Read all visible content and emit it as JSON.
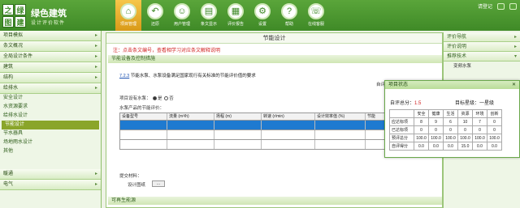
{
  "app": {
    "logo_chars": [
      "之",
      "绿",
      "图",
      "建"
    ],
    "title": "绿色建筑",
    "subtitle": "设计评价软件",
    "user": "请登记"
  },
  "nav": [
    {
      "label": "项目管理",
      "icon": "house-icon",
      "glyph": "⌂",
      "active": true
    },
    {
      "label": "还原",
      "icon": "undo-icon",
      "glyph": "↶",
      "active": false
    },
    {
      "label": "用户管理",
      "icon": "users-icon",
      "glyph": "☺",
      "active": false
    },
    {
      "label": "条文显示",
      "icon": "document-icon",
      "glyph": "▤",
      "active": false
    },
    {
      "label": "评价报告",
      "icon": "report-icon",
      "glyph": "▦",
      "active": false
    },
    {
      "label": "设置",
      "icon": "gear-icon",
      "glyph": "⚙",
      "active": false
    },
    {
      "label": "帮助",
      "icon": "help-icon",
      "glyph": "?",
      "active": false
    },
    {
      "label": "在线客服",
      "icon": "chat-icon",
      "glyph": "☏",
      "active": false
    }
  ],
  "sidebar": {
    "sections": [
      "项目模拟",
      "条文概况",
      "全局设计条件",
      "建筑",
      "结构",
      "给排水"
    ],
    "subitems": [
      "安全设计",
      "水资源要求",
      "给排水设计",
      "节能设计",
      "节水器具",
      "场地雨水设计",
      "其他"
    ],
    "selected_index": 3,
    "bottom_sections": [
      "暖通",
      "电气"
    ]
  },
  "main": {
    "title": "节能设计",
    "note": "注：点击条文编号，查看相学习对应条文解释说明",
    "section1": "节能设备及控制措施",
    "clause_link": "7.2.3",
    "clause_text": "节能水泵、水泵设备满足国家现行有关标准的节能评价值的要求",
    "score_label": "自评",
    "question_label": "项目设有水泵：",
    "yes_label": "是",
    "no_label": "否",
    "product_label": "水泵产品的节能评价：",
    "columns": [
      "设备型号",
      "流量 (m³/h)",
      "扬程 (m)",
      "转速 (r/min)",
      "设计效率值 (%)",
      "节能"
    ],
    "attach_label": "提交材料：",
    "design_label": "设计图纸",
    "upload_button": "...",
    "section2": "可再生能源"
  },
  "right_panel": {
    "items": [
      "评价导航",
      "评价说明",
      "推荐技术"
    ],
    "link": "变频水泵"
  },
  "status": {
    "title": "项目状态",
    "self_score_label": "自评总分：",
    "self_score_value": "1.5",
    "target_label": "目标星级：一星级",
    "columns": [
      "",
      "安全",
      "健康",
      "生活",
      "资源",
      "环境",
      "创新"
    ],
    "rows": [
      {
        "label": "应达标项",
        "values": [
          "8",
          "9",
          "6",
          "10",
          "7",
          "0"
        ]
      },
      {
        "label": "已达标项",
        "values": [
          "0",
          "0",
          "0",
          "0",
          "0",
          "0"
        ]
      },
      {
        "label": "预评总分",
        "values": [
          "100.0",
          "100.0",
          "100.0",
          "100.0",
          "100.0",
          "100.0"
        ]
      },
      {
        "label": "自评得分",
        "values": [
          "0.0",
          "0.0",
          "0.0",
          "15.0",
          "0.0",
          "0.0"
        ]
      }
    ]
  },
  "colors": {
    "header": "#4a962f",
    "accent": "#f2b733",
    "selection": "#1e7ad0",
    "note_red": "#d01f1f"
  }
}
